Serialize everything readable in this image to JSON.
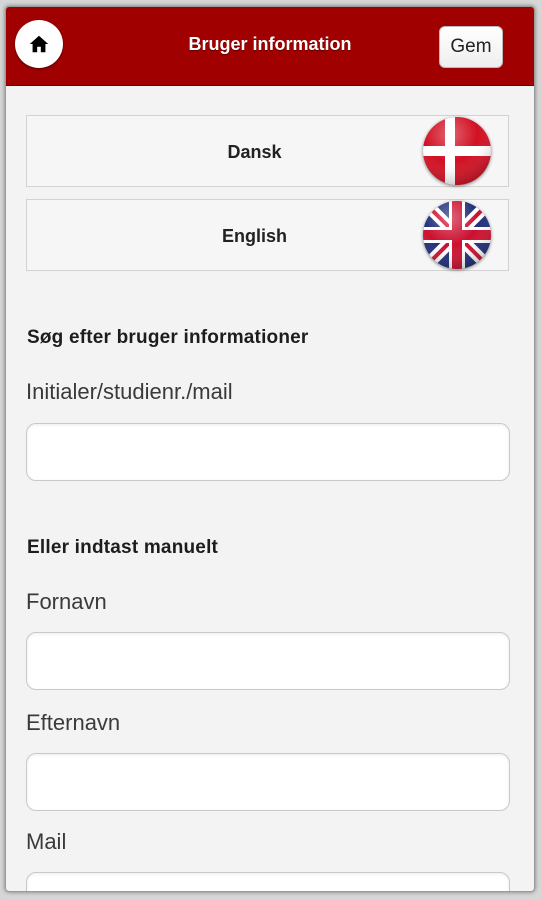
{
  "header": {
    "home_icon": "home-icon",
    "title": "Bruger information",
    "save_label": "Gem",
    "color": "#a00000"
  },
  "languages": [
    {
      "label": "Dansk",
      "flag_icon": "denmark-flag-icon"
    },
    {
      "label": "English",
      "flag_icon": "uk-flag-icon"
    }
  ],
  "search": {
    "heading": "Søg efter bruger informationer",
    "label": "Initialer/studienr./mail",
    "value": ""
  },
  "manual": {
    "heading": "Eller indtast manuelt",
    "fields": [
      {
        "label": "Fornavn",
        "value": ""
      },
      {
        "label": "Efternavn",
        "value": ""
      },
      {
        "label": "Mail",
        "value": ""
      }
    ]
  }
}
